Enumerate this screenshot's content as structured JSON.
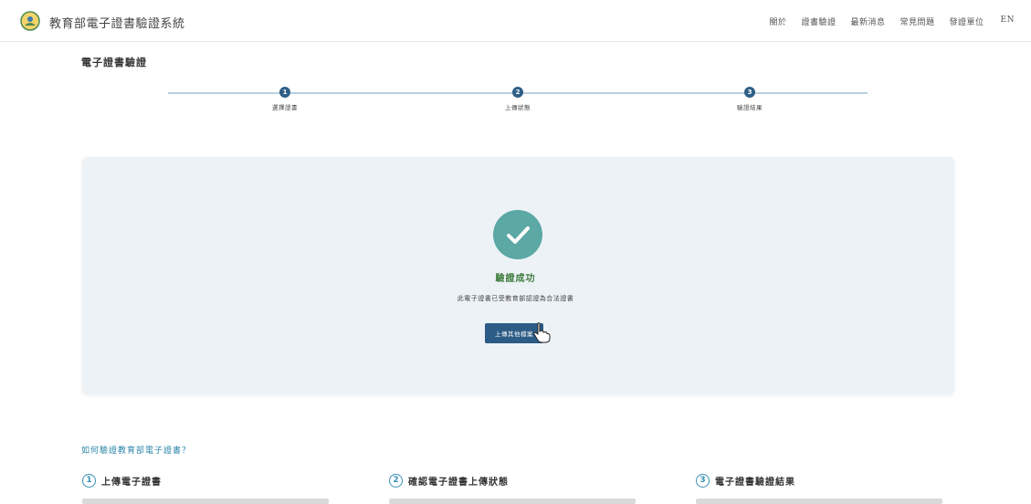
{
  "header": {
    "site_title": "教育部電子證書驗證系統",
    "logo_icon": "ministry-emblem-icon",
    "nav": [
      "關於",
      "證書驗證",
      "最新消息",
      "常見問題",
      "發證單位",
      "EN"
    ]
  },
  "page": {
    "heading": "電子證書驗證"
  },
  "stepper": {
    "steps": [
      {
        "num": "1",
        "label": "選擇證書"
      },
      {
        "num": "2",
        "label": "上傳狀態"
      },
      {
        "num": "3",
        "label": "驗證結果"
      }
    ]
  },
  "result": {
    "icon": "check-icon",
    "title": "驗證成功",
    "description": "此電子證書已受教育部認證為合法證書",
    "button_label": "上傳其他檔案"
  },
  "howto": {
    "heading": "如何驗證教育部電子證書？",
    "steps": [
      {
        "num": "1",
        "title": "上傳電子證書"
      },
      {
        "num": "2",
        "title": "確認電子證書上傳狀態"
      },
      {
        "num": "3",
        "title": "電子證書驗證結果"
      }
    ]
  },
  "colors": {
    "accent": "#2c5b85",
    "success": "#5ba8a4",
    "success_text": "#3c7a3a",
    "panel_bg": "#edf2f7",
    "link": "#2b86a8"
  }
}
